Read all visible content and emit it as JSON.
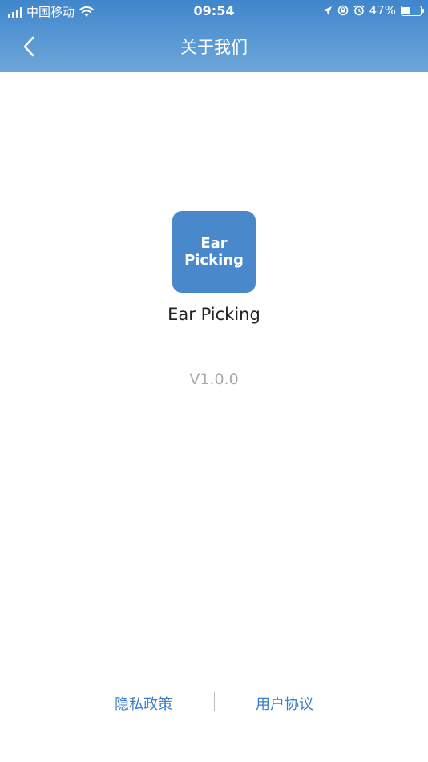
{
  "status_bar": {
    "carrier": "中国移动",
    "time": "09:54",
    "battery_percent": "47%",
    "battery_level": 0.47
  },
  "nav": {
    "title": "关于我们"
  },
  "app": {
    "icon_text_line1": "Ear",
    "icon_text_line2": "Picking",
    "name": "Ear Picking",
    "version": "V1.0.0"
  },
  "footer": {
    "privacy_label": "隐私政策",
    "terms_label": "用户协议"
  },
  "colors": {
    "header_top": "#3f86cc",
    "accent": "#4a88cc",
    "link": "#3c7fc4"
  }
}
